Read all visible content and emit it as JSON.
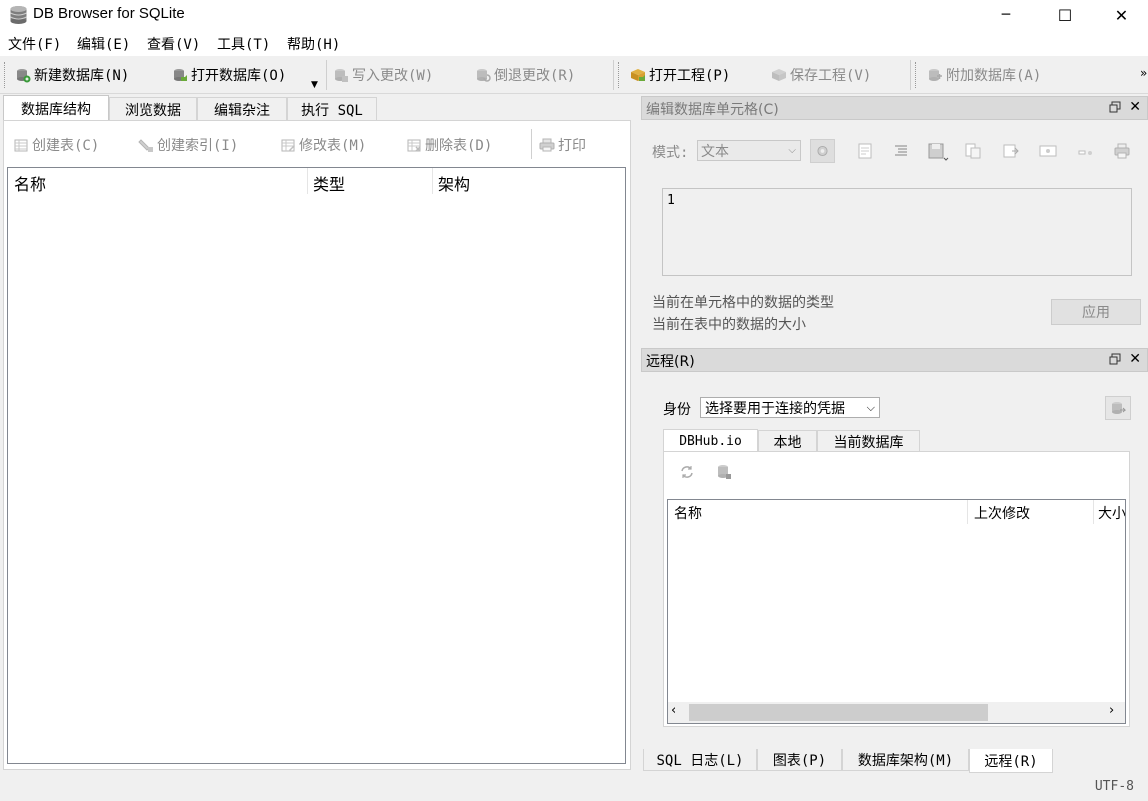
{
  "window": {
    "title": "DB Browser for SQLite",
    "minimize": "─",
    "maximize": "☐",
    "close": "✕"
  },
  "menu": [
    "文件(F)",
    "编辑(E)",
    "查看(V)",
    "工具(T)",
    "帮助(H)"
  ],
  "toolbar": {
    "new_db": "新建数据库(N)",
    "open_db": "打开数据库(O)",
    "write_changes": "写入更改(W)",
    "revert_changes": "倒退更改(R)",
    "open_project": "打开工程(P)",
    "save_project": "保存工程(V)",
    "attach_db": "附加数据库(A)",
    "overflow": "»"
  },
  "main_tabs": [
    "数据库结构",
    "浏览数据",
    "编辑杂注",
    "执行 SQL"
  ],
  "structure": {
    "create_table": "创建表(C)",
    "create_index": "创建索引(I)",
    "modify_table": "修改表(M)",
    "delete_table": "删除表(D)",
    "print": "打印",
    "columns": [
      "名称",
      "类型",
      "架构"
    ]
  },
  "edit_cell": {
    "title": "编辑数据库单元格(C)",
    "mode_label": "模式:",
    "mode_value": "文本",
    "value": "1",
    "type_info": "当前在单元格中的数据的类型",
    "size_info": "当前在表中的数据的大小",
    "apply": "应用"
  },
  "remote": {
    "title": "远程(R)",
    "identity_label": "身份",
    "identity_value": "选择要用于连接的凭据",
    "tabs": [
      "DBHub.io",
      "本地",
      "当前数据库"
    ],
    "columns": [
      "名称",
      "上次修改",
      "大小"
    ]
  },
  "bottom_tabs": [
    "SQL 日志(L)",
    "图表(P)",
    "数据库架构(M)",
    "远程(R)"
  ],
  "status": {
    "encoding": "UTF-8"
  },
  "colors": {
    "dock_header": "#dadada",
    "disabled_text": "#8a8a8a",
    "tree_border": "#828790"
  }
}
